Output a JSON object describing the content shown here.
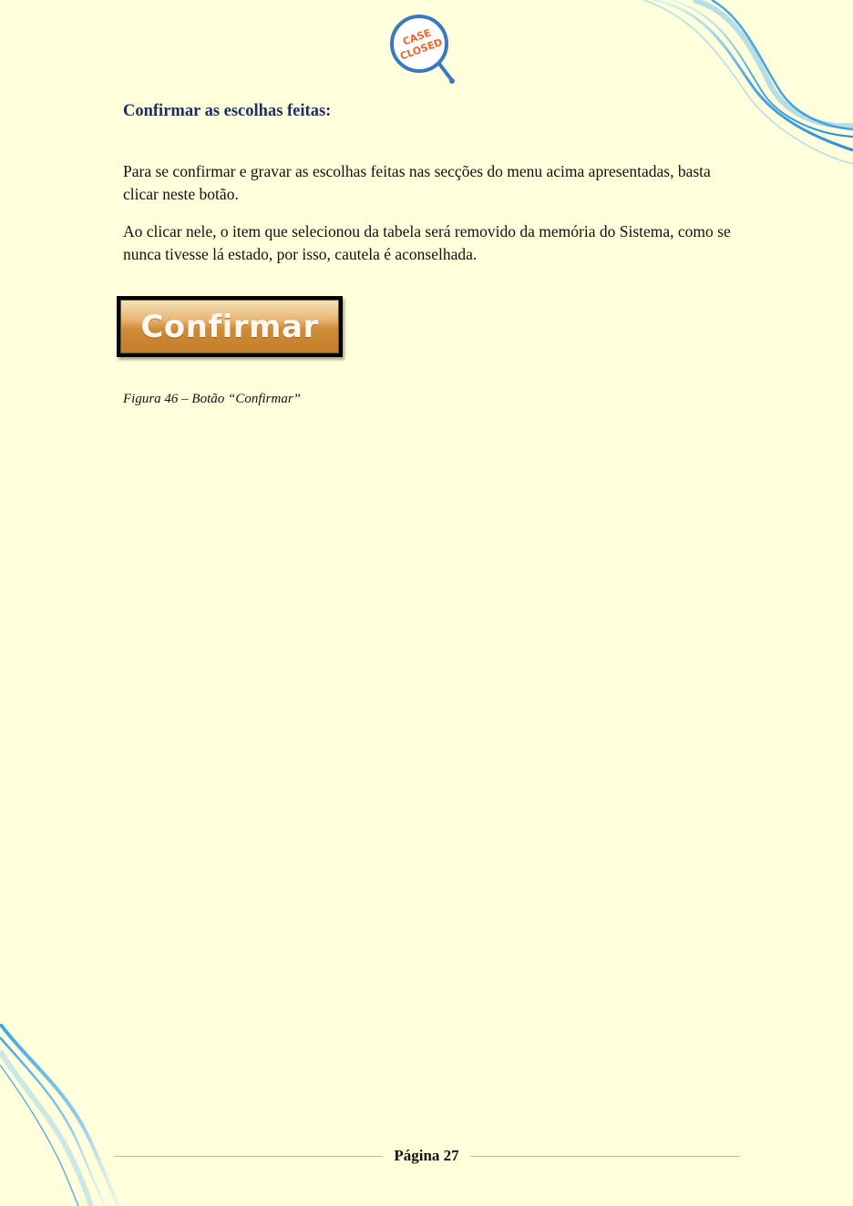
{
  "logo": {
    "line1": "CASE",
    "line2": "CLOSED"
  },
  "section": {
    "heading": "Confirmar as escolhas feitas:",
    "paragraphs": [
      "Para se confirmar e gravar as escolhas feitas nas secções do menu acima apresentadas, basta clicar neste botão.",
      "Ao clicar nele, o item que selecionou da tabela será removido da memória do Sistema, como se nunca tivesse lá estado, por isso, cautela é aconselhada."
    ]
  },
  "figure": {
    "button_label": "Confirmar",
    "caption": "Figura 46 – Botão “Confirmar”"
  },
  "footer": {
    "page_label": "Página 27"
  },
  "colors": {
    "page_background": "#ffffdc",
    "heading": "#1b2f66",
    "logo_accent": "#3a78c2",
    "logo_text": "#e8682a",
    "wave": "#2a9be6"
  }
}
